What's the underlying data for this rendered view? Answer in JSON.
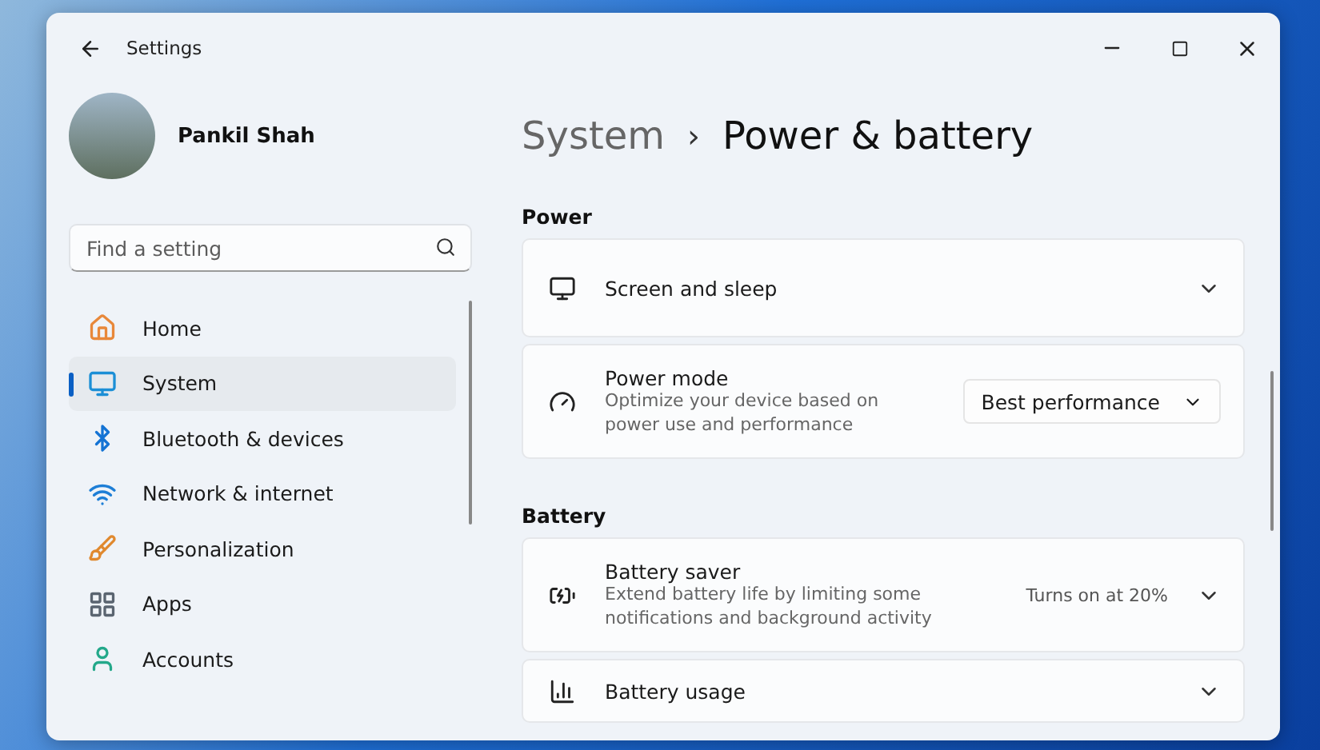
{
  "window": {
    "title": "Settings"
  },
  "profile": {
    "name": "Pankil Shah"
  },
  "search": {
    "placeholder": "Find a setting"
  },
  "sidebar": {
    "items": [
      {
        "label": "Home",
        "selected": false
      },
      {
        "label": "System",
        "selected": true
      },
      {
        "label": "Bluetooth & devices",
        "selected": false
      },
      {
        "label": "Network & internet",
        "selected": false
      },
      {
        "label": "Personalization",
        "selected": false
      },
      {
        "label": "Apps",
        "selected": false
      },
      {
        "label": "Accounts",
        "selected": false
      }
    ]
  },
  "breadcrumb": {
    "parent": "System",
    "separator": "›",
    "current": "Power & battery"
  },
  "sections": [
    {
      "title": "Power",
      "cards": [
        {
          "kind": "expander",
          "title": "Screen and sleep"
        },
        {
          "kind": "dropdown",
          "title": "Power mode",
          "description": "Optimize your device based on power use and performance",
          "value": "Best performance"
        }
      ]
    },
    {
      "title": "Battery",
      "cards": [
        {
          "kind": "expander",
          "title": "Battery saver",
          "description": "Extend battery life by limiting some notifications and background activity",
          "status": "Turns on at 20%"
        },
        {
          "kind": "expander",
          "title": "Battery usage"
        }
      ]
    }
  ]
}
